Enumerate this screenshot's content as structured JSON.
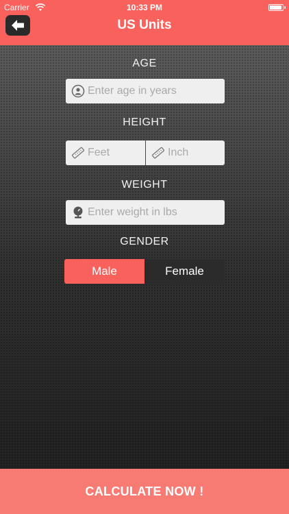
{
  "status_bar": {
    "carrier": "Carrier",
    "time": "10:33 PM"
  },
  "nav": {
    "title": "US Units",
    "back_icon": "arrow-left-icon"
  },
  "form": {
    "age": {
      "label": "AGE",
      "placeholder": "Enter age in years",
      "icon": "person-icon"
    },
    "height": {
      "label": "HEIGHT",
      "feet_placeholder": "Feet",
      "inch_placeholder": "Inch",
      "icon": "ruler-icon"
    },
    "weight": {
      "label": "WEIGHT",
      "placeholder": "Enter weight in lbs",
      "icon": "scale-icon"
    },
    "gender": {
      "label": "GENDER",
      "options": [
        "Male",
        "Female"
      ],
      "selected": "Male"
    }
  },
  "calculate_label": "CALCULATE NOW !",
  "colors": {
    "accent": "#f8615c",
    "button": "#f77a73",
    "field_bg": "#efefef",
    "dark_segment": "#2b2b2b"
  }
}
